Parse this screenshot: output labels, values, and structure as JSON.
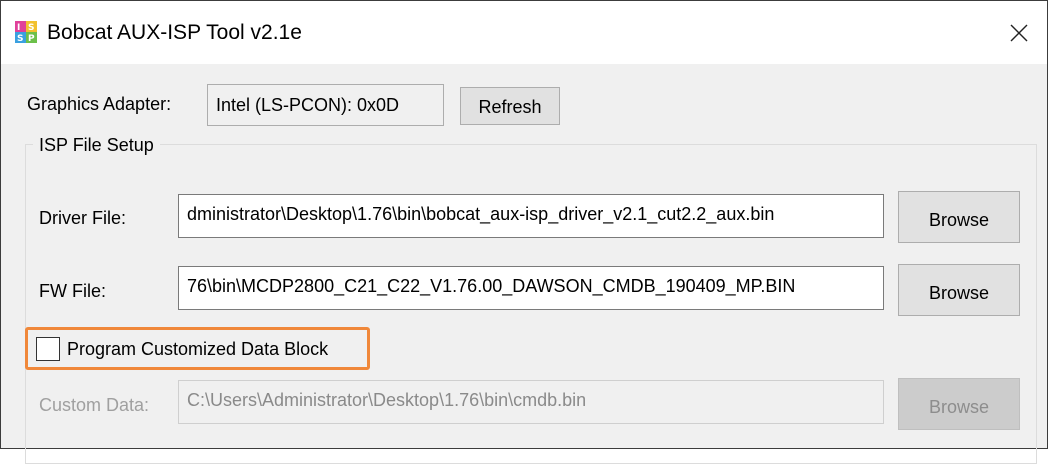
{
  "window": {
    "title": "Bobcat AUX-ISP Tool v2.1e",
    "app_icon": "isp-app-icon",
    "close_icon": "close-icon"
  },
  "adapter": {
    "label": "Graphics Adapter:",
    "value": "Intel (LS-PCON): 0x0D",
    "refresh_label": "Refresh"
  },
  "isp_setup": {
    "group_title": "ISP File Setup",
    "driver": {
      "label": "Driver File:",
      "value": "dministrator\\Desktop\\1.76\\bin\\bobcat_aux-isp_driver_v2.1_cut2.2_aux.bin",
      "browse_label": "Browse"
    },
    "fw": {
      "label": "FW File:",
      "value": "76\\bin\\MCDP2800_C21_C22_V1.76.00_DAWSON_CMDB_190409_MP.BIN",
      "browse_label": "Browse"
    },
    "custom_block": {
      "checkbox_label": "Program Customized Data Block",
      "checked": false,
      "highlight_color": "#f0883a"
    },
    "custom_data": {
      "label": "Custom Data:",
      "value": "C:\\Users\\Administrator\\Desktop\\1.76\\bin\\cmdb.bin",
      "browse_label": "Browse",
      "enabled": false
    }
  }
}
